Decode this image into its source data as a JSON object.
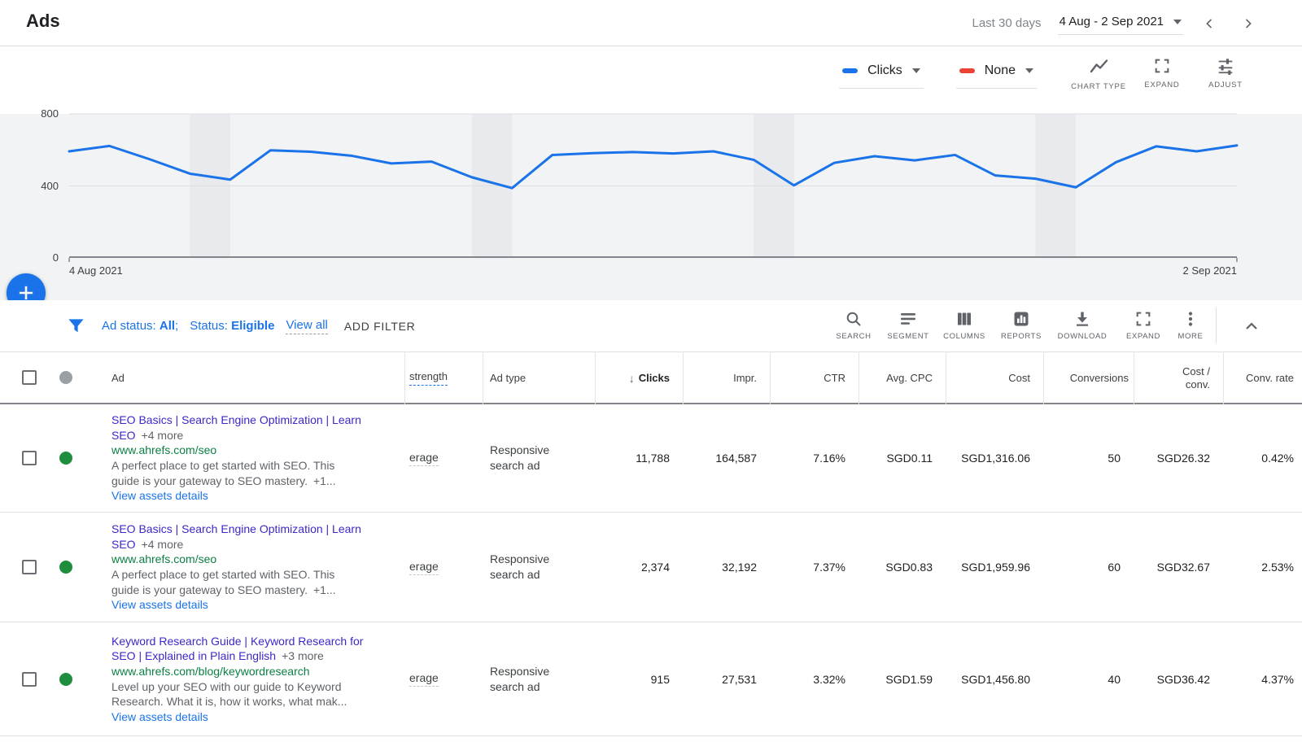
{
  "topbar": {
    "title": "Ads",
    "range_label": "Last 30 days",
    "range_value": "4 Aug - 2 Sep 2021"
  },
  "colors": {
    "accent_blue": "#1a73e8",
    "series2_red": "#ea4335",
    "headline_purple": "#3b28c9",
    "url_green": "#0b8043",
    "status_green": "#1e8e3e",
    "plot_bg": "#f1f3f4",
    "weekend_band": "#e8eaed"
  },
  "chart_controls": {
    "series1": {
      "label": "Clicks",
      "color": "#1a73e8"
    },
    "series2": {
      "label": "None",
      "color": "#ea4335"
    },
    "tools": {
      "chart_type": "CHART TYPE",
      "expand": "EXPAND",
      "adjust": "ADJUST"
    }
  },
  "chart_data": {
    "type": "line",
    "title": "",
    "xlabel": "",
    "ylabel": "Clicks",
    "ylim": [
      0,
      800
    ],
    "yticks": [
      0,
      400,
      800
    ],
    "x_first_label": "4 Aug 2021",
    "x_last_label": "2 Sep 2021",
    "grid": true,
    "legend_position": "none",
    "weekend_bands": [
      [
        3,
        4
      ],
      [
        10,
        11
      ],
      [
        17,
        18
      ],
      [
        24,
        25
      ]
    ],
    "series": [
      {
        "name": "Clicks",
        "color": "#1a73e8",
        "dates": [
          "4 Aug",
          "5 Aug",
          "6 Aug",
          "7 Aug",
          "8 Aug",
          "9 Aug",
          "10 Aug",
          "11 Aug",
          "12 Aug",
          "13 Aug",
          "14 Aug",
          "15 Aug",
          "16 Aug",
          "17 Aug",
          "18 Aug",
          "19 Aug",
          "20 Aug",
          "21 Aug",
          "22 Aug",
          "23 Aug",
          "24 Aug",
          "25 Aug",
          "26 Aug",
          "27 Aug",
          "28 Aug",
          "29 Aug",
          "30 Aug",
          "31 Aug",
          "1 Sep",
          "2 Sep"
        ],
        "values": [
          592,
          622,
          548,
          468,
          435,
          598,
          590,
          568,
          525,
          535,
          448,
          388,
          572,
          582,
          588,
          580,
          592,
          545,
          403,
          528,
          565,
          542,
          572,
          458,
          440,
          392,
          532,
          620,
          592,
          625
        ]
      }
    ]
  },
  "fab": {
    "label": "+"
  },
  "filter_bar": {
    "status_label_1": "Ad status:",
    "status_value_1": "All",
    "separator": ";",
    "status_label_2": "Status:",
    "status_value_2": "Eligible",
    "view_all": "View all",
    "add_filter": "ADD FILTER"
  },
  "toolbar": {
    "items": [
      {
        "label": "SEARCH"
      },
      {
        "label": "SEGMENT"
      },
      {
        "label": "COLUMNS"
      },
      {
        "label": "REPORTS"
      },
      {
        "label": "DOWNLOAD"
      },
      {
        "label": "EXPAND"
      },
      {
        "label": "MORE"
      }
    ]
  },
  "table": {
    "headers": {
      "ad": "Ad",
      "strength": "strength",
      "ad_type": "Ad type",
      "clicks": "Clicks",
      "impr": "Impr.",
      "ctr": "CTR",
      "avg_cpc": "Avg. CPC",
      "cost": "Cost",
      "conversions": "Conversions",
      "cost_conv": "Cost / conv.",
      "conv_rate": "Conv. rate"
    },
    "rows": [
      {
        "headline": "SEO Basics | Search Engine Optimization | Learn SEO",
        "more": "+4 more",
        "url": "www.ahrefs.com/seo",
        "description": "A perfect place to get started with SEO. This guide is your gateway to SEO mastery.",
        "description_more": "+1...",
        "assets_link": "View assets details",
        "strength": "erage",
        "ad_type": "Responsive search ad",
        "clicks": "11,788",
        "impr": "164,587",
        "ctr": "7.16%",
        "avg_cpc": "SGD0.11",
        "cost": "SGD1,316.06",
        "conversions": "50",
        "cost_conv": "SGD26.32",
        "conv_rate": "0.42%"
      },
      {
        "headline": "SEO Basics | Search Engine Optimization | Learn SEO",
        "more": "+4 more",
        "url": "www.ahrefs.com/seo",
        "description": "A perfect place to get started with SEO. This guide is your gateway to SEO mastery.",
        "description_more": "+1...",
        "assets_link": "View assets details",
        "strength": "erage",
        "ad_type": "Responsive search ad",
        "clicks": "2,374",
        "impr": "32,192",
        "ctr": "7.37%",
        "avg_cpc": "SGD0.83",
        "cost": "SGD1,959.96",
        "conversions": "60",
        "cost_conv": "SGD32.67",
        "conv_rate": "2.53%"
      },
      {
        "headline": "Keyword Research Guide | Keyword Research for SEO | Explained in Plain English",
        "more": "+3 more",
        "url": "www.ahrefs.com/blog/keywordresearch",
        "description": "Level up your SEO with our guide to Keyword Research. What it is, how it works, what mak...",
        "description_more": "",
        "assets_link": "View assets details",
        "strength": "erage",
        "ad_type": "Responsive search ad",
        "clicks": "915",
        "impr": "27,531",
        "ctr": "3.32%",
        "avg_cpc": "SGD1.59",
        "cost": "SGD1,456.80",
        "conversions": "40",
        "cost_conv": "SGD36.42",
        "conv_rate": "4.37%"
      }
    ]
  }
}
